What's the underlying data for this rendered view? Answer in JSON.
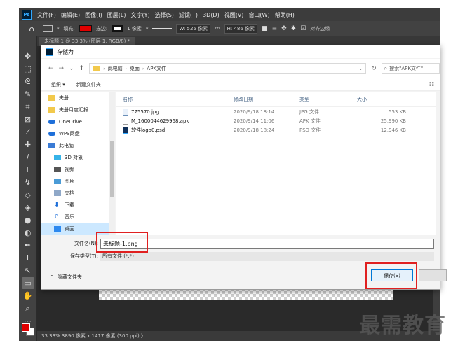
{
  "app": {
    "logo_text": "Ps",
    "menu": [
      "文件(F)",
      "编辑(E)",
      "图像(I)",
      "图层(L)",
      "文字(Y)",
      "选择(S)",
      "滤镜(T)",
      "3D(D)",
      "视图(V)",
      "窗口(W)",
      "帮助(H)"
    ]
  },
  "options_bar": {
    "home_icon": "home-icon",
    "fill_label": "填充:",
    "stroke_label": "描边:",
    "stroke_width": "1 像素",
    "width_field": "W: 525 像素",
    "height_field": "H: 486 像素",
    "align_label": "对齐边缘",
    "fill_color": "#e10000"
  },
  "document_tab": {
    "label": "未标题-1 @ 33.3% (图层 1, RGB/8) *"
  },
  "status_bar": {
    "text": "33.33%  3890 像素 x 1417 像素 (300 ppi)  〉"
  },
  "dialog": {
    "title": "存储为",
    "address": {
      "crumbs": [
        "此电脑",
        "桌面",
        "APK文件"
      ]
    },
    "search_placeholder": "搜索\"APK文件\"",
    "commands": {
      "organize": "组织 ▾",
      "new_folder": "新建文件夹"
    },
    "nav_items": [
      {
        "label": "夹册",
        "icon": "folder-icon"
      },
      {
        "label": "夹册月度汇报",
        "icon": "folder-icon"
      },
      {
        "label": "OneDrive",
        "icon": "cloud-icon"
      },
      {
        "label": "WPS网盘",
        "icon": "cloud-icon"
      },
      {
        "label": "此电脑",
        "icon": "pc-icon"
      },
      {
        "label": "3D 对象",
        "icon": "cube-icon"
      },
      {
        "label": "视频",
        "icon": "video-icon"
      },
      {
        "label": "图片",
        "icon": "picture-icon"
      },
      {
        "label": "文档",
        "icon": "document-icon"
      },
      {
        "label": "下载",
        "icon": "download-icon"
      },
      {
        "label": "音乐",
        "icon": "music-icon"
      },
      {
        "label": "桌面",
        "icon": "desktop-icon"
      }
    ],
    "columns": {
      "name": "名称",
      "date": "修改日期",
      "type": "类型",
      "size": "大小"
    },
    "files": [
      {
        "name": "775570.jpg",
        "date": "2020/9/18 18:14",
        "type": "JPG 文件",
        "size": "553 KB",
        "icon": "jpg-file-icon"
      },
      {
        "name": "M_1600044629968.apk",
        "date": "2020/9/14 11:06",
        "type": "APK 文件",
        "size": "25,990 KB",
        "icon": "apk-file-icon"
      },
      {
        "name": "软件logo0.psd",
        "date": "2020/9/18 18:24",
        "type": "PSD 文件",
        "size": "12,946 KB",
        "icon": "psd-file-icon"
      }
    ],
    "filename_label": "文件名(N):",
    "filename_value": "未标题-1.png",
    "filetype_label": "保存类型(T):",
    "filetype_value": "所有文件 (*.*)",
    "hide_folders": "隐藏文件夹",
    "save_button": "保存(S)"
  },
  "watermark": "最需教育",
  "colors": {
    "accent_red": "#e02020",
    "ps_blue": "#31a8ff",
    "selection_blue": "#cce8ff"
  }
}
